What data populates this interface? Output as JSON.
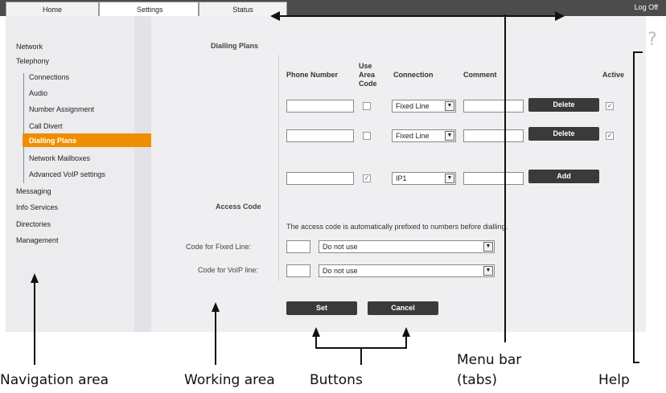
{
  "tabs": {
    "home": "Home",
    "settings": "Settings",
    "status": "Status",
    "logoff": "Log Off"
  },
  "nav": {
    "network": "Network",
    "telephony": "Telephony",
    "connections": "Connections",
    "audio": "Audio",
    "number_assignment": "Number Assignment",
    "call_divert": "Call Divert",
    "dialling_plans": "Dialling Plans",
    "network_mailboxes": "Network Mailboxes",
    "advanced_voip": "Advanced VoIP settings",
    "messaging": "Messaging",
    "info_services": "Info Services",
    "directories": "Directories",
    "management": "Management"
  },
  "work": {
    "section_title": "Dialling Plans",
    "col_phone": "Phone Number",
    "col_use": "Use",
    "col_area": "Area",
    "col_code": "Code",
    "col_connection": "Connection",
    "col_comment": "Comment",
    "col_active": "Active",
    "rows": [
      {
        "connection": "Fixed Line",
        "button": "Delete",
        "use_area_checked": false,
        "active": true
      },
      {
        "connection": "Fixed Line",
        "button": "Delete",
        "use_area_checked": false,
        "active": true
      },
      {
        "connection": "IP1",
        "button": "Add",
        "use_area_checked": true,
        "active": false
      }
    ],
    "access_title": "Access Code",
    "access_desc": "The access code is automatically prefixed to numbers before dialling.",
    "code_fixed_label": "Code for Fixed Line:",
    "code_voip_label": "Code for VoIP line:",
    "code_fixed_value": "Do not use",
    "code_voip_value": "Do not use",
    "set": "Set",
    "cancel": "Cancel",
    "help": "?"
  },
  "annotations": {
    "nav": "Navigation area",
    "work": "Working area",
    "buttons": "Buttons",
    "menu1": "Menu bar",
    "menu2": "(tabs)",
    "help": "Help"
  },
  "colors": {
    "accent": "#f18e00",
    "topbar": "#4c4c4c",
    "button": "#3a3a3a"
  }
}
